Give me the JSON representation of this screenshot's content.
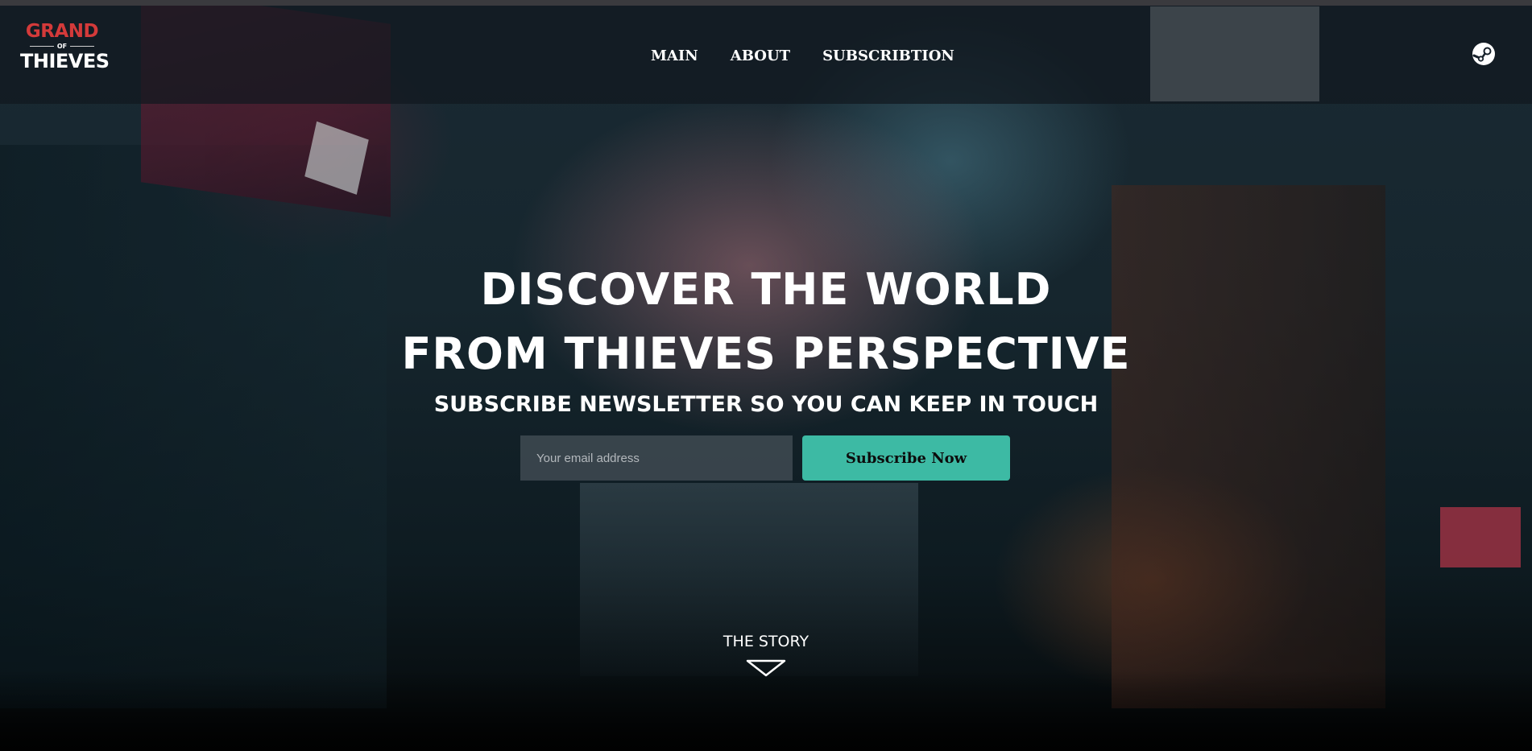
{
  "logo": {
    "line1": "GRAND",
    "line2": "OF",
    "line3": "THIEVES",
    "accent_color": "#d43a3a"
  },
  "nav": {
    "items": [
      {
        "label": "MAIN"
      },
      {
        "label": "ABOUT"
      },
      {
        "label": "SUBSCRIBTION"
      }
    ],
    "right_icon": "steam-icon"
  },
  "hero": {
    "title_line1": "DISCOVER THE WORLD",
    "title_line2": "FROM THIEVES PERSPECTIVE",
    "subtitle": "SUBSCRIBE NEWSLETTER SO YOU CAN KEEP IN TOUCH"
  },
  "form": {
    "email_placeholder": "Your email address",
    "email_value": "",
    "button_label": "Subscribe Now",
    "button_color": "#3dbaa4"
  },
  "story": {
    "label": "THE STORY",
    "icon": "chevron-down-icon"
  }
}
